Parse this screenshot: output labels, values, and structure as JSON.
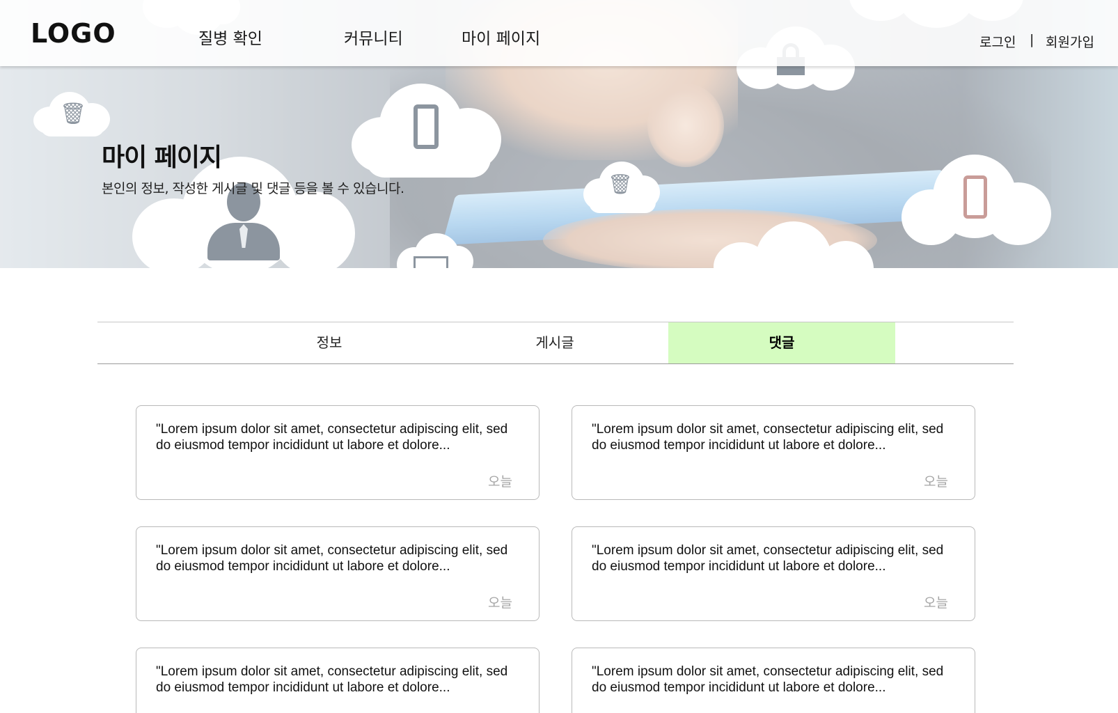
{
  "header": {
    "logo": "LOGO",
    "nav": [
      "질병 확인",
      "커뮤니티",
      "마이 페이지"
    ],
    "login": "로그인",
    "separator": "|",
    "signup": "회원가입"
  },
  "hero": {
    "title": "마이 페이지",
    "subtitle": "본인의 정보, 작성한 게시글 및 댓글 등을 볼 수 있습니다."
  },
  "tabs": [
    {
      "label": "정보",
      "active": false
    },
    {
      "label": "게시글",
      "active": false
    },
    {
      "label": "댓글",
      "active": true
    }
  ],
  "comments": [
    {
      "text": "\"Lorem ipsum dolor sit amet, consectetur adipiscing elit, sed do eiusmod tempor incididunt ut labore et dolore...",
      "date": "오늘"
    },
    {
      "text": "\"Lorem ipsum dolor sit amet, consectetur adipiscing elit, sed do eiusmod tempor incididunt ut labore et dolore...",
      "date": "오늘"
    },
    {
      "text": "\"Lorem ipsum dolor sit amet, consectetur adipiscing elit, sed do eiusmod tempor incididunt ut labore et dolore...",
      "date": "오늘"
    },
    {
      "text": "\"Lorem ipsum dolor sit amet, consectetur adipiscing elit, sed do eiusmod tempor incididunt ut labore et dolore...",
      "date": "오늘"
    },
    {
      "text": "\"Lorem ipsum dolor sit amet, consectetur adipiscing elit, sed do eiusmod tempor incididunt ut labore et dolore...",
      "date": ""
    },
    {
      "text": "\"Lorem ipsum dolor sit amet, consectetur adipiscing elit, sed do eiusmod tempor incididunt ut labore et dolore...",
      "date": ""
    }
  ],
  "colors": {
    "active_tab": "#d5fcc0",
    "date_text": "#a5a5a5",
    "card_border": "#b9b9b9"
  }
}
